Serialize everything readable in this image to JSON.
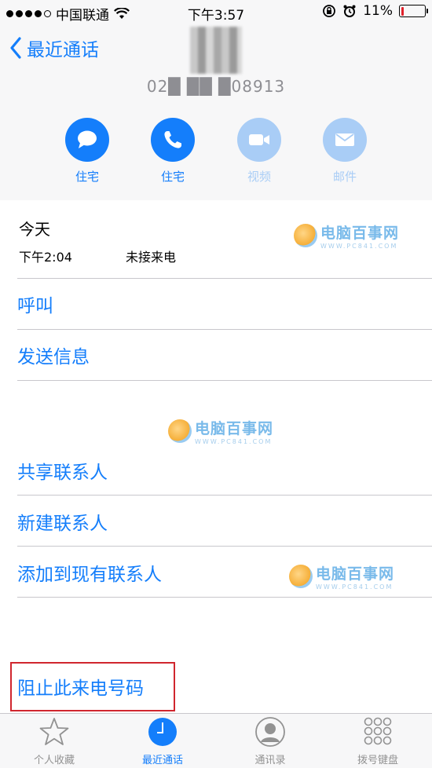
{
  "status_bar": {
    "carrier": "中国联通",
    "time": "下午3:57",
    "battery": "11%",
    "battery_level": 0.11
  },
  "nav": {
    "back_label": "最近通话"
  },
  "contact": {
    "number": "02█ ██ █08913"
  },
  "actions": [
    {
      "label": "住宅",
      "icon": "message-icon",
      "enabled": true
    },
    {
      "label": "住宅",
      "icon": "phone-icon",
      "enabled": true
    },
    {
      "label": "视频",
      "icon": "video-icon",
      "enabled": false
    },
    {
      "label": "邮件",
      "icon": "mail-icon",
      "enabled": false
    }
  ],
  "recent": {
    "title": "今天",
    "time": "下午2:04",
    "type": "未接来电"
  },
  "options": {
    "call": "呼叫",
    "send_message": "发送信息",
    "share_contact": "共享联系人",
    "new_contact": "新建联系人",
    "add_to_existing": "添加到现有联系人",
    "block_caller": "阻止此来电号码"
  },
  "watermark": {
    "main": "电脑百事网",
    "sub": "WWW.PC841.COM"
  },
  "tabs": [
    {
      "label": "个人收藏",
      "icon": "star-icon"
    },
    {
      "label": "最近通话",
      "icon": "clock-icon"
    },
    {
      "label": "通讯录",
      "icon": "contacts-icon"
    },
    {
      "label": "拨号键盘",
      "icon": "keypad-icon"
    }
  ],
  "colors": {
    "accent": "#147efb",
    "highlight": "#d0262e",
    "battery_low": "#e0202a"
  }
}
